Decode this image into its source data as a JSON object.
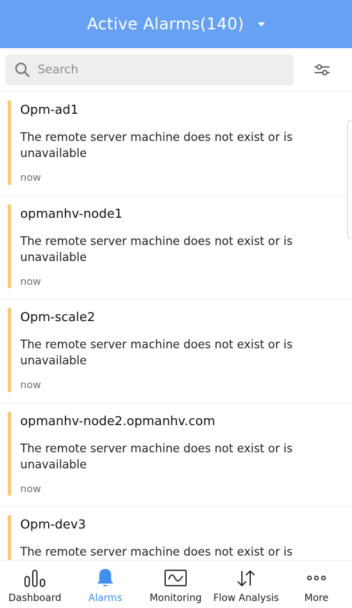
{
  "header": {
    "title": "Active Alarms(140)"
  },
  "search": {
    "placeholder": "Search",
    "value": ""
  },
  "alarms": [
    {
      "name": "Opm-ad1",
      "message": "The remote server machine does not exist or is unavailable",
      "time": "now"
    },
    {
      "name": "opmanhv-node1",
      "message": "The remote server machine does not exist or is unavailable",
      "time": "now"
    },
    {
      "name": "Opm-scale2",
      "message": "The remote server machine does not exist or is unavailable",
      "time": "now"
    },
    {
      "name": "opmanhv-node2.opmanhv.com",
      "message": "The remote server machine does not exist or is unavailable",
      "time": "now"
    },
    {
      "name": "Opm-dev3",
      "message": "The remote server machine does not exist or is unavailable",
      "time": ""
    }
  ],
  "nav": [
    {
      "label": "Dashboard",
      "icon": "dashboard-icon",
      "active": false
    },
    {
      "label": "Alarms",
      "icon": "bell-icon",
      "active": true
    },
    {
      "label": "Monitoring",
      "icon": "monitoring-icon",
      "active": false
    },
    {
      "label": "Flow Analysis",
      "icon": "flow-analysis-icon",
      "active": false
    },
    {
      "label": "More",
      "icon": "more-icon",
      "active": false
    }
  ],
  "colors": {
    "header_bg": "#66a1f3",
    "severity_bar": "#f5c982",
    "active_nav": "#3f8ff0"
  }
}
